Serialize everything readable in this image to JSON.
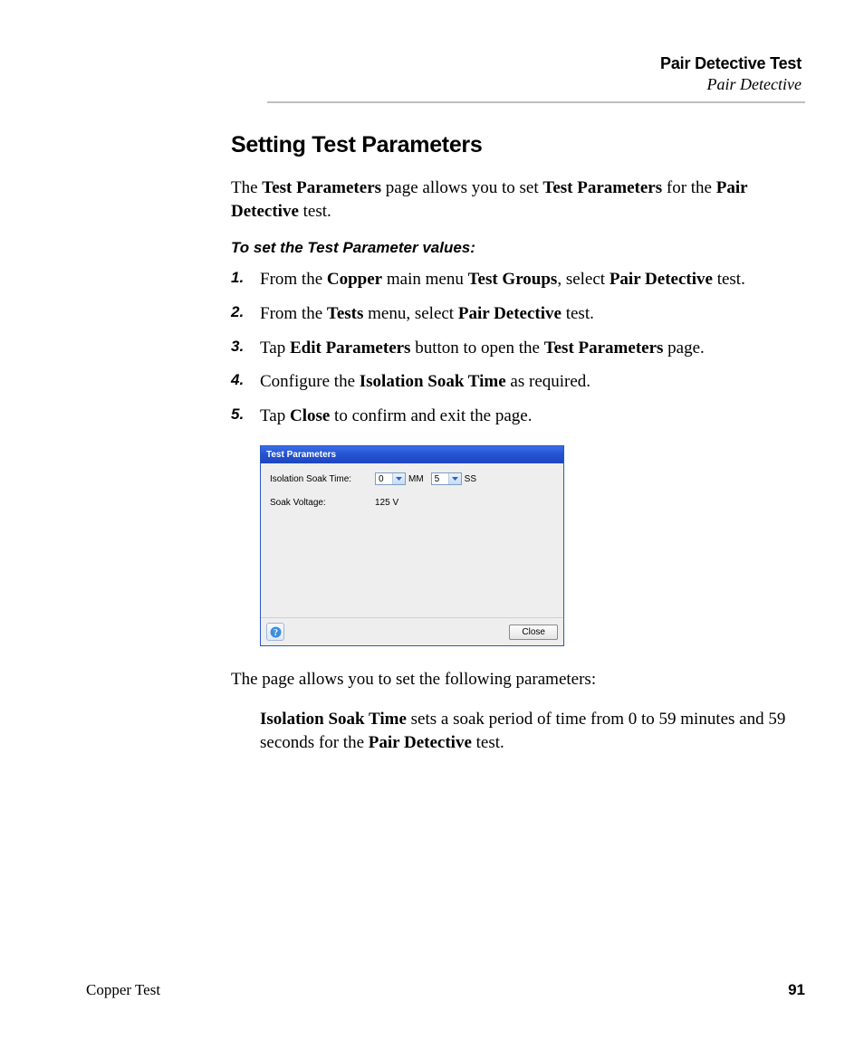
{
  "header": {
    "title": "Pair Detective Test",
    "subtitle": "Pair Detective"
  },
  "section_title": "Setting Test Parameters",
  "intro": {
    "t1": "The ",
    "b1": "Test Parameters",
    "t2": " page allows you to set ",
    "b2": "Test Parameters",
    "t3": " for the ",
    "b3": "Pair Detective",
    "t4": " test."
  },
  "subheading": "To set the Test Parameter values:",
  "steps": [
    {
      "t1": "From the ",
      "b1": "Copper",
      "t2": " main menu ",
      "b2": "Test Groups",
      "t3": ", select ",
      "b3": "Pair Detective",
      "t4": " test."
    },
    {
      "t1": "From the ",
      "b1": "Tests",
      "t2": " menu, select ",
      "b2": "Pair Detective",
      "t3": " test.",
      "b3": "",
      "t4": ""
    },
    {
      "t1": "Tap ",
      "b1": "Edit Parameters",
      "t2": " button to open the ",
      "b2": "Test Parameters",
      "t3": " page.",
      "b3": "",
      "t4": ""
    },
    {
      "t1": "Configure the ",
      "b1": "Isolation Soak Time",
      "t2": " as required.",
      "b2": "",
      "t3": "",
      "b3": "",
      "t4": ""
    },
    {
      "t1": "Tap ",
      "b1": "Close",
      "t2": " to confirm and exit the page.",
      "b2": "",
      "t3": "",
      "b3": "",
      "t4": ""
    }
  ],
  "dialog": {
    "title": "Test Parameters",
    "row1_label": "Isolation Soak Time:",
    "mm_value": "0",
    "mm_unit": "MM",
    "ss_value": "5",
    "ss_unit": "SS",
    "row2_label": "Soak Voltage:",
    "row2_value": "125 V",
    "close_label": "Close"
  },
  "post_para": "The page allows you to set the following parameters:",
  "desc": {
    "b1": "Isolation Soak Time",
    "t1": " sets a soak period of time from 0 to 59 minutes and 59 seconds for the ",
    "b2": "Pair Detective",
    "t2": " test."
  },
  "footer": {
    "left": "Copper Test",
    "page": "91"
  }
}
